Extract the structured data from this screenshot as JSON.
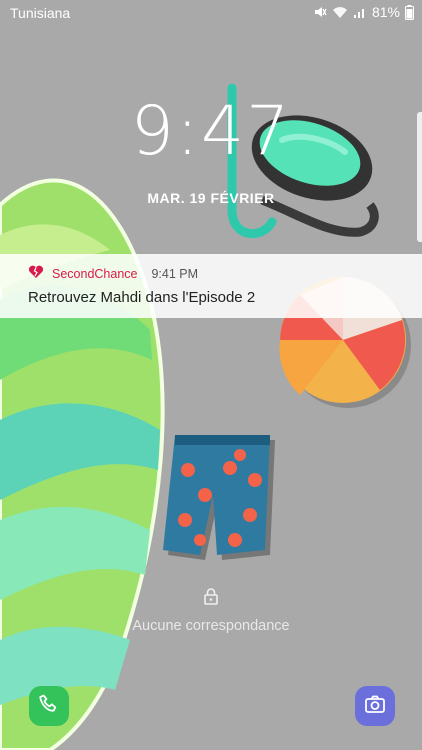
{
  "status_bar": {
    "carrier": "Tunisiana",
    "battery": "81%",
    "icons": [
      "mute-icon",
      "wifi-icon",
      "signal-icon"
    ]
  },
  "lockscreen": {
    "time": "9:47",
    "date": "MAR. 19 FÉVRIER",
    "lock_message": "Aucune correspondance"
  },
  "notification": {
    "app_name": "SecondChance",
    "time": "9:41 PM",
    "body": "Retrouvez Mahdi dans l'Episode 2",
    "app_color": "#d81b49"
  },
  "shortcuts": {
    "left": "phone-icon",
    "right": "camera-icon"
  },
  "colors": {
    "wallpaper": "#a9a9a9",
    "phone_button": "#34c25a",
    "camera_button": "#6a6fdc"
  }
}
